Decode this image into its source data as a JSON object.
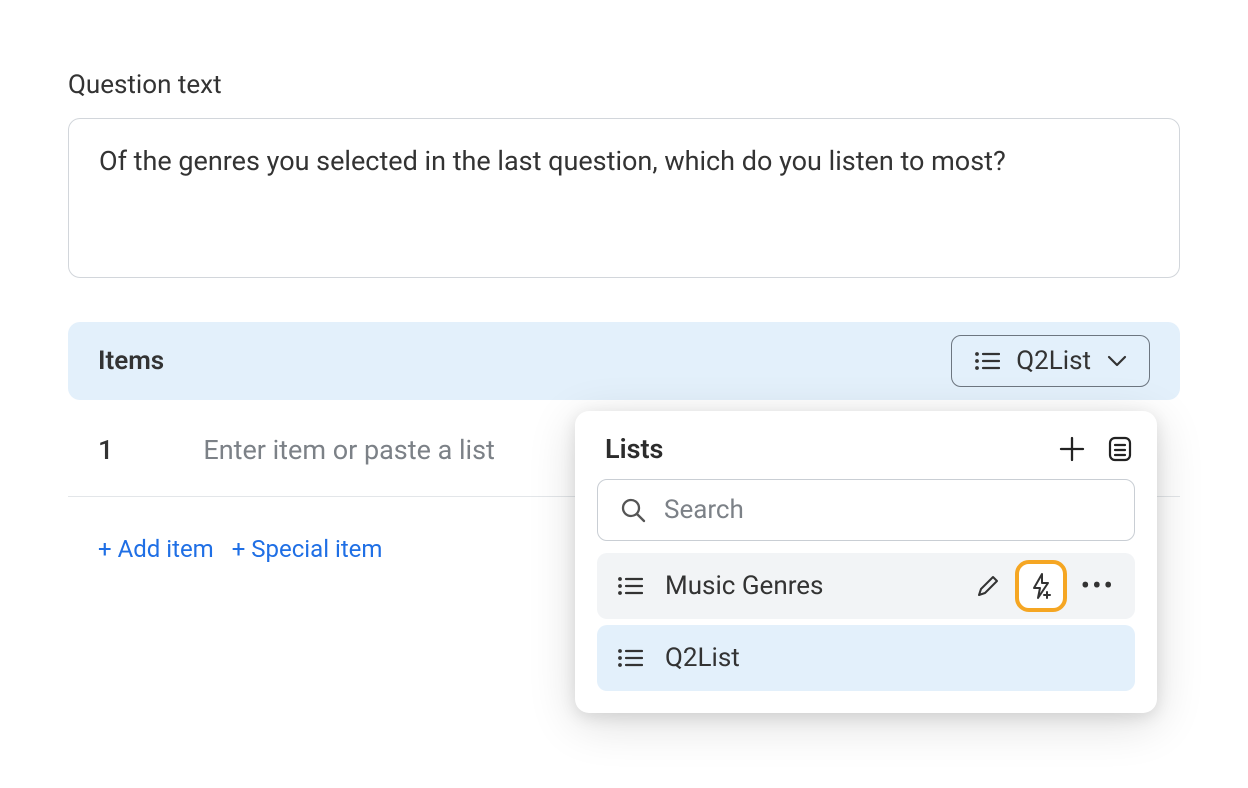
{
  "question": {
    "label": "Question text",
    "text": "Of the genres you selected in the last question, which do you listen to most?"
  },
  "items_section": {
    "title": "Items",
    "selected_list": "Q2List",
    "rows": [
      {
        "index": "1",
        "placeholder": "Enter item or paste a list"
      }
    ],
    "add_item": "+ Add item",
    "special_item": "+ Special item"
  },
  "popover": {
    "title": "Lists",
    "search_placeholder": "Search",
    "lists": [
      {
        "name": "Music Genres",
        "hover": true,
        "show_actions": true
      },
      {
        "name": "Q2List",
        "selected": true
      }
    ]
  }
}
